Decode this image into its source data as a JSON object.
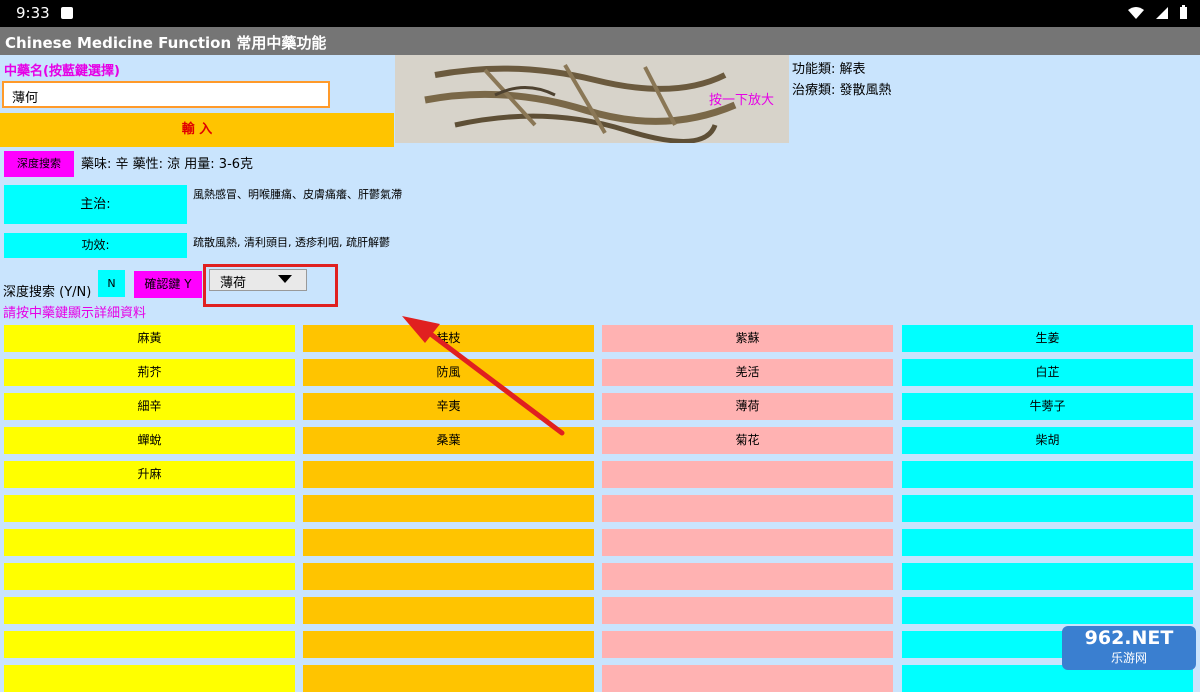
{
  "status_bar": {
    "time": "9:33"
  },
  "app_title": "Chinese Medicine Function 常用中藥功能",
  "herb": {
    "label": "中藥名(按藍鍵選擇)",
    "input_value": "薄何",
    "input_button": "輸 入",
    "zoom_hint": "按一下放大"
  },
  "info": {
    "func_class": "功能類: 解表",
    "treat_class": "治療類: 發散風熱",
    "deep_search_button": "深度搜索",
    "properties": "藥味: 辛 藥性: 涼 用量: 3-6克",
    "indication_label": "主治:",
    "indication_text": "風熱感冒、明喉腫痛、皮膚痛癢、肝鬱氣滯",
    "efficacy_label": "功效:",
    "efficacy_text": "疏散風熱, 清利頭目, 透疹利咽, 疏肝解鬱"
  },
  "deep_search": {
    "label": "深度搜索 (Y/N)",
    "yn_value": "N",
    "confirm_button": "確認鍵 Y",
    "dropdown_value": "薄荷"
  },
  "hint": "請按中藥鍵顯示詳細資料",
  "grid": [
    [
      "麻黃",
      "桂枝",
      "紫蘇",
      "生姜"
    ],
    [
      "荊芥",
      "防風",
      "羌活",
      "白芷"
    ],
    [
      "細辛",
      "辛夷",
      "薄荷",
      "牛蒡子"
    ],
    [
      "蟬蛻",
      "桑葉",
      "菊花",
      "柴胡"
    ],
    [
      "升麻",
      "",
      "",
      ""
    ],
    [
      "",
      "",
      "",
      ""
    ],
    [
      "",
      "",
      "",
      ""
    ],
    [
      "",
      "",
      "",
      ""
    ],
    [
      "",
      "",
      "",
      ""
    ],
    [
      "",
      "",
      "",
      ""
    ],
    [
      "",
      "",
      "",
      ""
    ]
  ],
  "watermark": {
    "top": "962.NET",
    "bottom": "乐游网"
  },
  "colors": {
    "yellow": "#ffff00",
    "orange": "#ffc400",
    "pink": "#ffb2b2",
    "cyan": "#00ffff",
    "magenta": "#ff00ff",
    "annotation": "#e02020"
  }
}
